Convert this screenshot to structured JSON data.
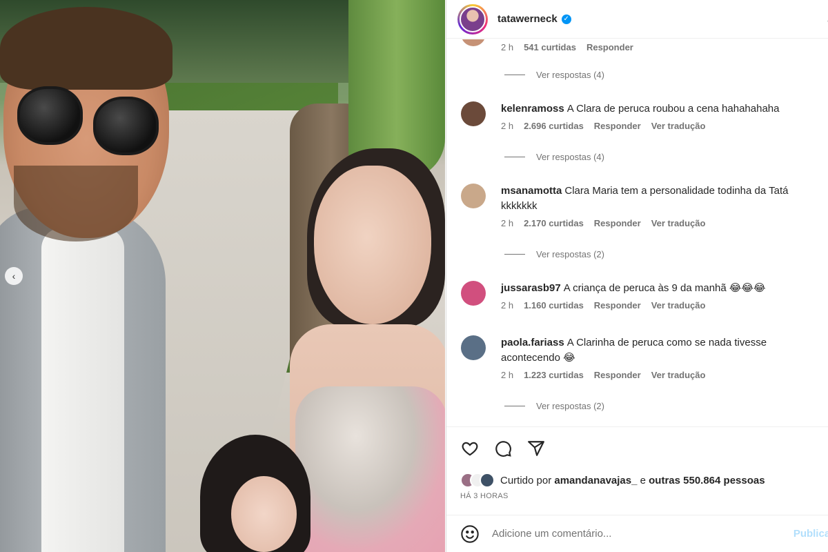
{
  "post": {
    "username": "tatawerneck",
    "verified": true,
    "time_ago": "HÁ 3 HORAS",
    "likes": {
      "prefix": "Curtido por",
      "first_user": "amandanavajas_",
      "connector": "e",
      "others": "outras 550.864 pessoas"
    }
  },
  "photo": {
    "carousel_prev_icon": "chevron-left-icon"
  },
  "comments": {
    "first": {
      "time": "2 h",
      "likes": "541 curtidas",
      "reply": "Responder",
      "replies_label": "Ver respostas (4)"
    },
    "items": [
      {
        "user": "kelenramoss",
        "text": "A Clara de peruca roubou a cena hahahahaha",
        "time": "2 h",
        "likes": "2.696 curtidas",
        "reply": "Responder",
        "translate": "Ver tradução",
        "replies_label": "Ver respostas (4)",
        "avatar_color": "#6b4a3a"
      },
      {
        "user": "msanamotta",
        "text": "Clara Maria tem a personalidade todinha da Tatá kkkkkkk",
        "time": "2 h",
        "likes": "2.170 curtidas",
        "reply": "Responder",
        "translate": "Ver tradução",
        "replies_label": "Ver respostas (2)",
        "avatar_color": "#c9a88a"
      },
      {
        "user": "jussarasb97",
        "text": "A criança de peruca às 9 da manhã 😂😂😂",
        "time": "2 h",
        "likes": "1.160 curtidas",
        "reply": "Responder",
        "translate": "Ver tradução",
        "replies_label": "",
        "avatar_color": "#d14f7e"
      },
      {
        "user": "paola.fariass",
        "text": "A Clarinha de peruca como se nada tivesse acontecendo 😂",
        "time": "2 h",
        "likes": "1.223 curtidas",
        "reply": "Responder",
        "translate": "Ver tradução",
        "replies_label": "Ver respostas (2)",
        "avatar_color": "#5a6f86"
      }
    ]
  },
  "actions": {
    "like_icon": "heart-icon",
    "comment_icon": "comment-icon",
    "share_icon": "send-icon"
  },
  "add_comment": {
    "placeholder": "Adicione um comentário...",
    "publish_label": "Publicar",
    "emoji_icon": "emoji-icon"
  },
  "colors": {
    "verified": "#0095f6",
    "publish_disabled": "#b2dffc",
    "secondary_text": "#737373"
  }
}
